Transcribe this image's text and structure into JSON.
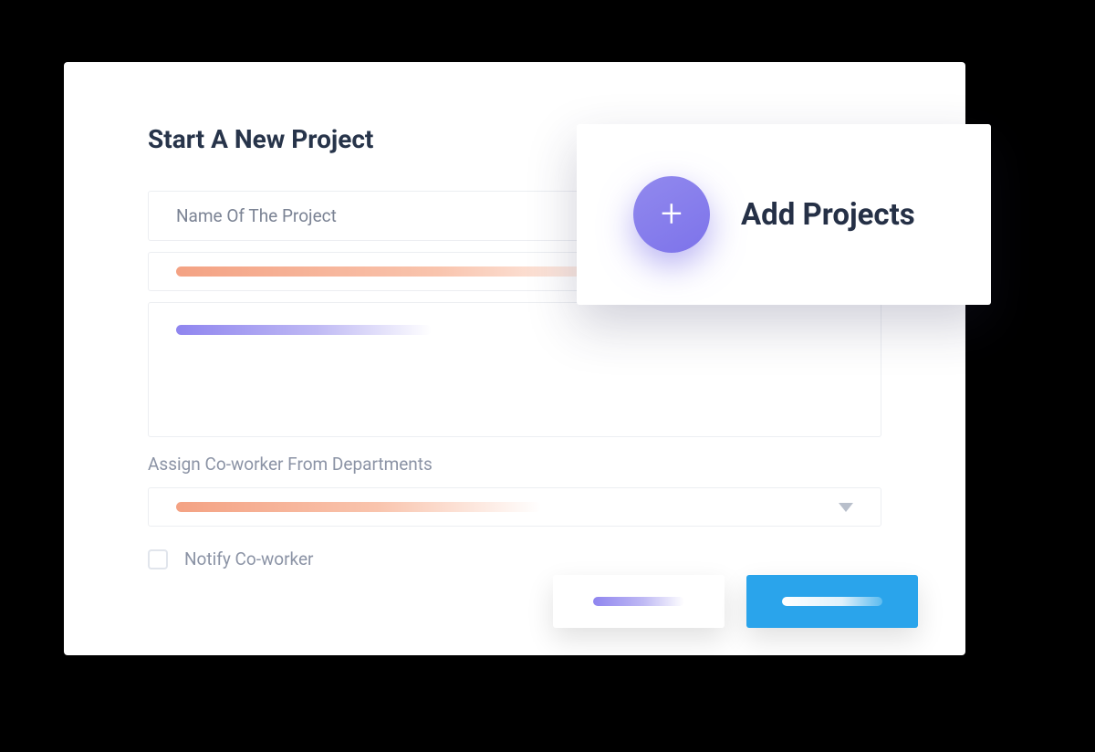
{
  "form": {
    "title": "Start A New Project",
    "project_name_placeholder": "Name Of The Project",
    "assign_label": "Assign Co-worker From Departments",
    "notify_label": "Notify Co-worker"
  },
  "add_card": {
    "label": "Add Projects"
  }
}
